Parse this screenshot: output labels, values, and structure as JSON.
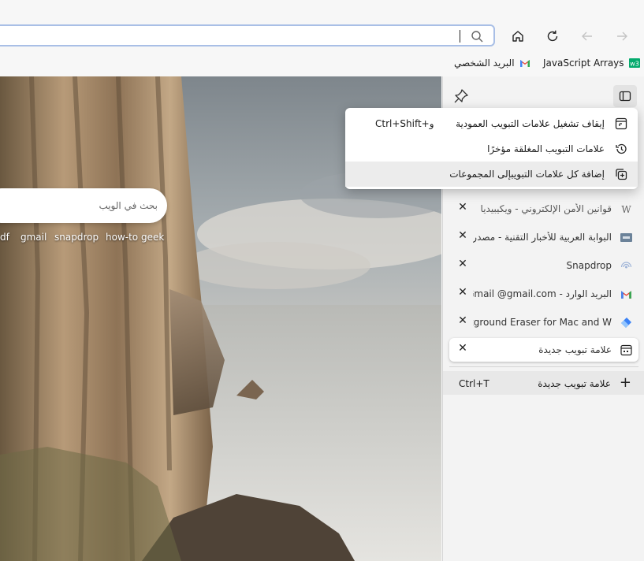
{
  "toolbar": {
    "address_value": "",
    "search_icon": "search-icon",
    "buttons": [
      "home-icon",
      "refresh-icon",
      "back-icon",
      "forward-icon"
    ]
  },
  "favorites": [
    {
      "label": "JavaScript Arrays",
      "icon": "w3-icon",
      "color": "#04aa6d"
    },
    {
      "label": "البريد الشخصي",
      "icon": "gmail-icon"
    }
  ],
  "new_tab_page": {
    "search_placeholder": "بحث في الويب",
    "quick_links": [
      "df",
      "gmail",
      "snapdrop",
      "how-to geek"
    ]
  },
  "context_menu": {
    "items": [
      {
        "label": "إيقاف تشغيل علامات التبويب العمودية",
        "shortcut": "Ctrl+Shift+و",
        "icon": "vertical-tabs-off-icon"
      },
      {
        "label": "علامات التبويب المغلقة مؤخرًا",
        "shortcut": "",
        "icon": "history-icon"
      },
      {
        "label": "إضافة كل علامات التبويبإلى المجموعات",
        "shortcut": "",
        "icon": "add-to-collections-icon"
      }
    ]
  },
  "vertical_tabs": {
    "tabs": [
      {
        "title": "قوانين الأمن الإلكتروني - ويكيبيديا",
        "icon": "wikipedia-icon"
      },
      {
        "title": "البوابة العربية للأخبار التقنية - مصدر",
        "icon": "site-favicon"
      },
      {
        "title": "Snapdrop",
        "icon": "snapdrop-icon"
      },
      {
        "title": "البريد الوارد - Gmail @gmail.com",
        "icon": "gmail-icon"
      },
      {
        "title": "Background Eraser for Mac and W",
        "icon": "eraser-icon"
      },
      {
        "title": "علامة تبويب جديدة",
        "icon": "new-tab-page-icon",
        "active": true
      }
    ],
    "new_tab": {
      "label": "علامة تبويب جديدة",
      "shortcut": "Ctrl+T"
    }
  }
}
